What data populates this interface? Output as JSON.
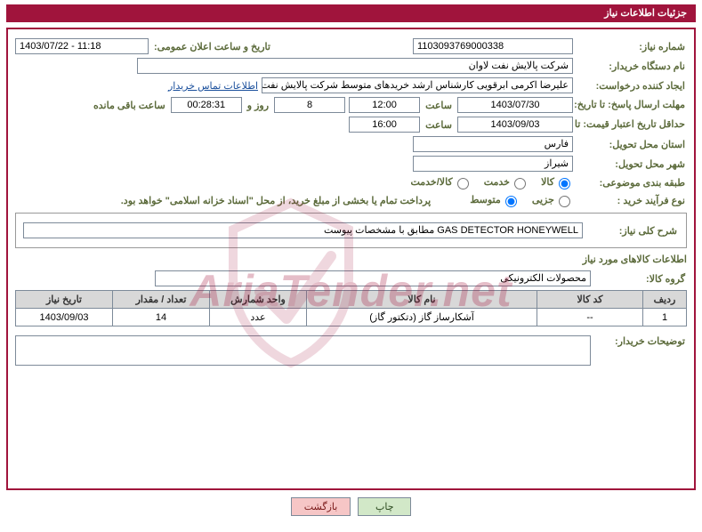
{
  "header": {
    "title": "جزئیات اطلاعات نیاز"
  },
  "labels": {
    "need_no": "شماره نیاز:",
    "announce_dt": "تاریخ و ساعت اعلان عمومی:",
    "buyer_org": "نام دستگاه خریدار:",
    "requester": "ایجاد کننده درخواست:",
    "buyer_contact": "اطلاعات تماس خریدار",
    "reply_deadline": "مهلت ارسال پاسخ: تا تاریخ:",
    "hour": "ساعت",
    "days_and": "روز و",
    "remaining": "ساعت باقی مانده",
    "price_validity": "حداقل تاریخ اعتبار قیمت: تا تاریخ:",
    "delivery_province": "استان محل تحویل:",
    "delivery_city": "شهر محل تحویل:",
    "subject_cat": "طبقه بندی موضوعی:",
    "purchase_type": "نوع فرآیند خرید :",
    "general_desc": "شرح کلی نیاز:",
    "items_info": "اطلاعات کالاهای مورد نیاز",
    "item_group": "گروه کالا:",
    "buyer_notes": "توضیحات خریدار:",
    "print": "چاپ",
    "back": "بازگشت",
    "payment_note": "پرداخت تمام یا بخشی از مبلغ خرید، از محل \"اسناد خزانه اسلامی\" خواهد بود."
  },
  "radios": {
    "goods": "کالا",
    "service": "خدمت",
    "goods_service": "کالا/خدمت",
    "partial": "جزیی",
    "medium": "متوسط"
  },
  "need_no": "1103093769000338",
  "announce_dt": "1403/07/22 - 11:18",
  "buyer_org": "شرکت پالایش نفت لاوان",
  "requester": "علیرضا اکرمی ابرقویی کارشناس ارشد خریدهای متوسط شرکت پالایش نفت لاو",
  "reply_date": "1403/07/30",
  "reply_time": "12:00",
  "days_remaining": "8",
  "time_remaining": "00:28:31",
  "validity_date": "1403/09/03",
  "validity_time": "16:00",
  "province": "فارس",
  "city": "شیراز",
  "general_desc": "GAS DETECTOR HONEYWELL مطابق با مشخصات پیوست",
  "item_group": "محصولات الکترونیکی",
  "table": {
    "headers": {
      "row": "ردیف",
      "item_code": "کد کالا",
      "item_name": "نام کالا",
      "unit": "واحد شمارش",
      "qty": "تعداد / مقدار",
      "need_date": "تاریخ نیاز"
    },
    "rows": [
      {
        "row": "1",
        "item_code": "--",
        "item_name": "آشکارساز گاز (دتکتور گاز)",
        "unit": "عدد",
        "qty": "14",
        "need_date": "1403/09/03"
      }
    ]
  },
  "buyer_notes": "",
  "watermark": "AriaTender.net"
}
